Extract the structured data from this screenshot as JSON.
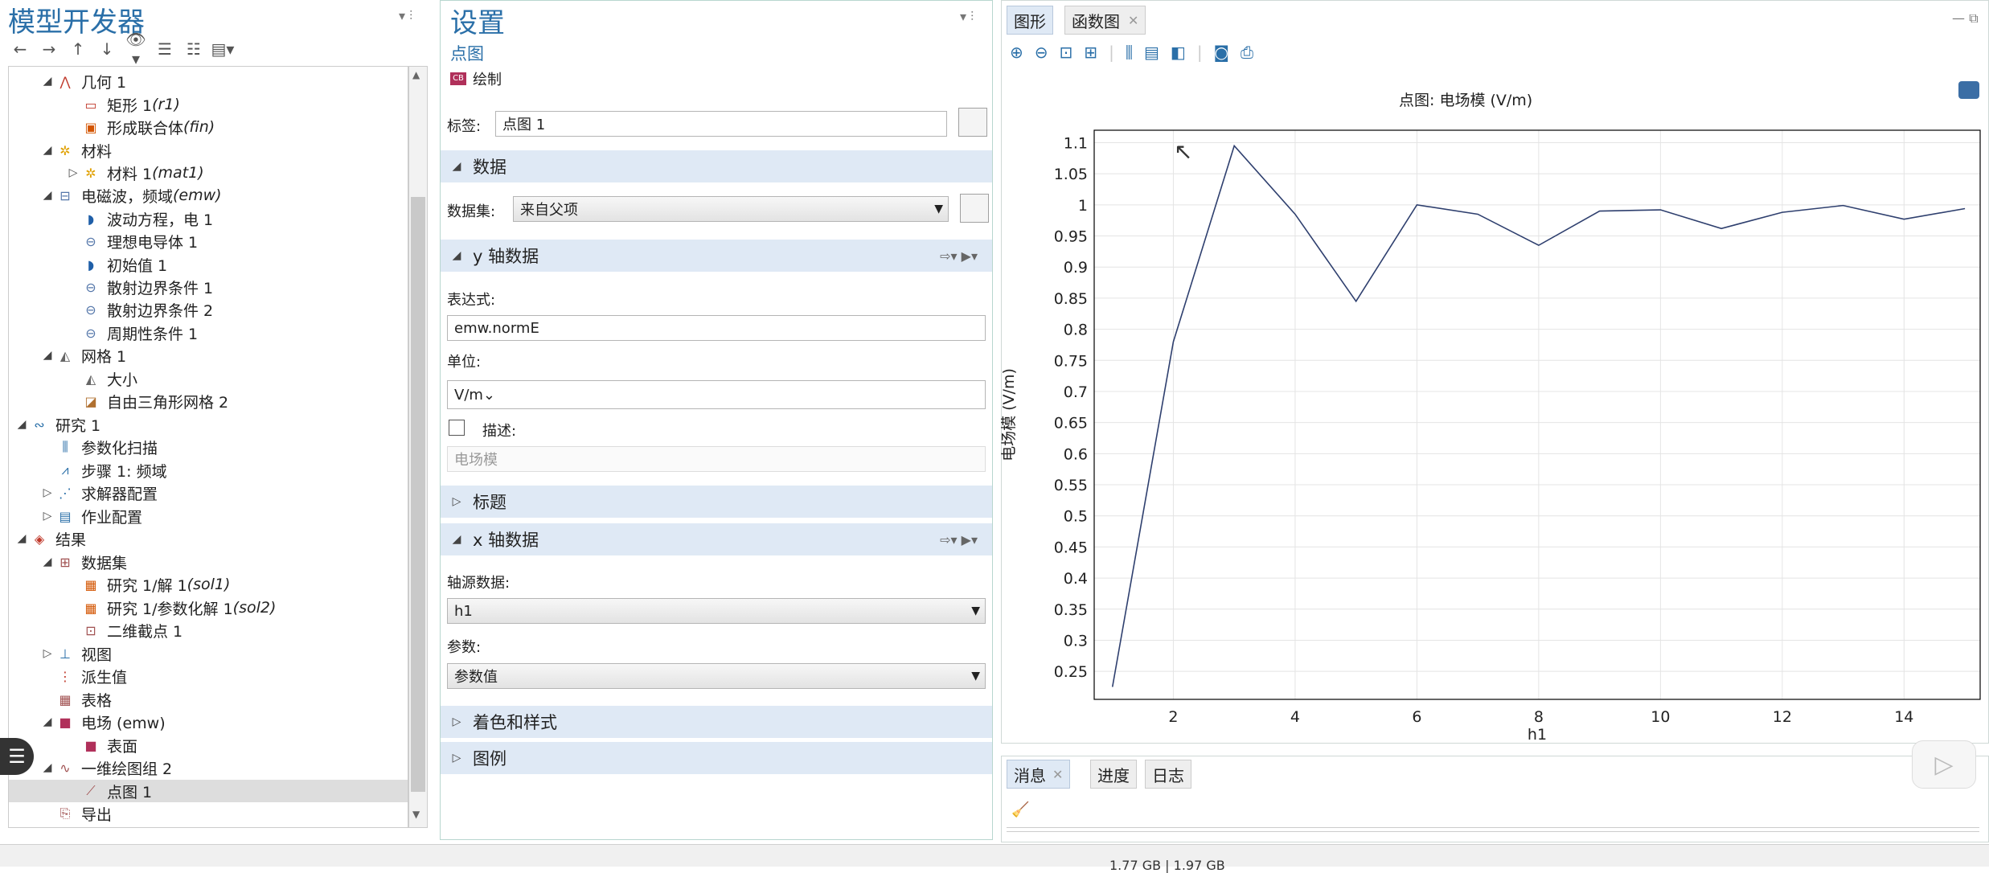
{
  "model_builder": {
    "title": "模型开发器",
    "tree": [
      {
        "label": "几何 1",
        "em": "",
        "indent": 2,
        "tw": "◢",
        "icon": "geometry-icon",
        "glyph": "⋀",
        "color": "#c0392b",
        "y": 96
      },
      {
        "label": "矩形 1 ",
        "em": "(r1)",
        "indent": 3,
        "tw": "",
        "icon": "rectangle-icon",
        "glyph": "▭",
        "color": "#c0392b",
        "y": 125
      },
      {
        "label": "形成联合体 ",
        "em": "(fin)",
        "indent": 3,
        "tw": "",
        "icon": "form-union-icon",
        "glyph": "▣",
        "color": "#d35400",
        "y": 153
      },
      {
        "label": "材料",
        "em": "",
        "indent": 2,
        "tw": "◢",
        "icon": "materials-icon",
        "glyph": "✲",
        "color": "#e0a000",
        "y": 182
      },
      {
        "label": "材料 1 ",
        "em": "(mat1)",
        "indent": 3,
        "tw": "▷",
        "icon": "material-icon",
        "glyph": "✲",
        "color": "#e0a000",
        "y": 210
      },
      {
        "label": "电磁波，频域 ",
        "em": "(emw)",
        "indent": 2,
        "tw": "◢",
        "icon": "emw-physics-icon",
        "glyph": "⊟",
        "color": "#5577aa",
        "y": 238
      },
      {
        "label": "波动方程，电 1",
        "em": "",
        "indent": 3,
        "tw": "",
        "icon": "wave-equation-icon",
        "glyph": "◗",
        "color": "#1f5fa8",
        "y": 267
      },
      {
        "label": "理想电导体 1",
        "em": "",
        "indent": 3,
        "tw": "",
        "icon": "pec-icon",
        "glyph": "⊖",
        "color": "#5577aa",
        "y": 295
      },
      {
        "label": "初始值 1",
        "em": "",
        "indent": 3,
        "tw": "",
        "icon": "initial-values-icon",
        "glyph": "◗",
        "color": "#1f5fa8",
        "y": 324
      },
      {
        "label": "散射边界条件 1",
        "em": "",
        "indent": 3,
        "tw": "",
        "icon": "scattering-boundary-icon",
        "glyph": "⊖",
        "color": "#5577aa",
        "y": 352
      },
      {
        "label": "散射边界条件 2",
        "em": "",
        "indent": 3,
        "tw": "",
        "icon": "scattering-boundary-icon",
        "glyph": "⊖",
        "color": "#5577aa",
        "y": 380
      },
      {
        "label": "周期性条件 1",
        "em": "",
        "indent": 3,
        "tw": "",
        "icon": "periodic-condition-icon",
        "glyph": "⊖",
        "color": "#5577aa",
        "y": 409
      },
      {
        "label": "网格 1",
        "em": "",
        "indent": 2,
        "tw": "◢",
        "icon": "mesh-icon",
        "glyph": "◭",
        "color": "#666",
        "y": 437
      },
      {
        "label": "大小",
        "em": "",
        "indent": 3,
        "tw": "",
        "icon": "size-icon",
        "glyph": "◭",
        "color": "#666",
        "y": 466
      },
      {
        "label": "自由三角形网格 2",
        "em": "",
        "indent": 3,
        "tw": "",
        "icon": "free-triangular-icon",
        "glyph": "◪",
        "color": "#b07030",
        "y": 494
      },
      {
        "label": "研究 1",
        "em": "",
        "indent": 1,
        "tw": "◢",
        "icon": "study-icon",
        "glyph": "∾",
        "color": "#2a6fa8",
        "y": 523
      },
      {
        "label": "参数化扫描",
        "em": "",
        "indent": 2,
        "tw": "",
        "icon": "parametric-sweep-icon",
        "glyph": "⫼",
        "color": "#2a6fa8",
        "y": 551
      },
      {
        "label": "步骤 1: 频域",
        "em": "",
        "indent": 2,
        "tw": "",
        "icon": "frequency-domain-icon",
        "glyph": "⩘",
        "color": "#2a6fa8",
        "y": 580
      },
      {
        "label": "求解器配置",
        "em": "",
        "indent": 2,
        "tw": "▷",
        "icon": "solver-config-icon",
        "glyph": "⋰",
        "color": "#2a6fa8",
        "y": 608
      },
      {
        "label": "作业配置",
        "em": "",
        "indent": 2,
        "tw": "▷",
        "icon": "job-config-icon",
        "glyph": "▤",
        "color": "#2a6fa8",
        "y": 637
      },
      {
        "label": "结果",
        "em": "",
        "indent": 1,
        "tw": "◢",
        "icon": "results-icon",
        "glyph": "◈",
        "color": "#c0392b",
        "y": 665
      },
      {
        "label": "数据集",
        "em": "",
        "indent": 2,
        "tw": "◢",
        "icon": "datasets-icon",
        "glyph": "⊞",
        "color": "#a05050",
        "y": 694
      },
      {
        "label": "研究 1/解 1 ",
        "em": "(sol1)",
        "indent": 3,
        "tw": "",
        "icon": "solution-dataset-icon",
        "glyph": "▦",
        "color": "#d35400",
        "y": 722
      },
      {
        "label": "研究 1/参数化解 1 ",
        "em": "(sol2)",
        "indent": 3,
        "tw": "",
        "icon": "parametric-solution-icon",
        "glyph": "▦",
        "color": "#d35400",
        "y": 751
      },
      {
        "label": "二维截点 1",
        "em": "",
        "indent": 3,
        "tw": "",
        "icon": "cut-point-icon",
        "glyph": "⊡",
        "color": "#a05050",
        "y": 779
      },
      {
        "label": "视图",
        "em": "",
        "indent": 2,
        "tw": "▷",
        "icon": "views-icon",
        "glyph": "⊥",
        "color": "#2a6fa8",
        "y": 808
      },
      {
        "label": "派生值",
        "em": "",
        "indent": 2,
        "tw": "",
        "icon": "derived-values-icon",
        "glyph": "⋮",
        "color": "#c0392b",
        "y": 836
      },
      {
        "label": "表格",
        "em": "",
        "indent": 2,
        "tw": "",
        "icon": "tables-icon",
        "glyph": "▦",
        "color": "#a05050",
        "y": 865
      },
      {
        "label": "电场 (emw)",
        "em": "",
        "indent": 2,
        "tw": "◢",
        "icon": "plot-group-2d-icon",
        "glyph": "■",
        "color": "#b0305a",
        "y": 893
      },
      {
        "label": "表面",
        "em": "",
        "indent": 3,
        "tw": "",
        "icon": "surface-plot-icon",
        "glyph": "■",
        "color": "#b0305a",
        "y": 922
      },
      {
        "label": "一维绘图组 2",
        "em": "",
        "indent": 2,
        "tw": "◢",
        "icon": "plot-group-1d-icon",
        "glyph": "∿",
        "color": "#a05050",
        "y": 950
      },
      {
        "label": "点图 1",
        "em": "",
        "indent": 3,
        "tw": "",
        "icon": "point-graph-icon",
        "glyph": "⟋",
        "color": "#a05050",
        "y": 979,
        "selected": true
      },
      {
        "label": "导出",
        "em": "",
        "indent": 2,
        "tw": "",
        "icon": "export-icon",
        "glyph": "⎘",
        "color": "#a05050",
        "y": 1007
      }
    ]
  },
  "settings": {
    "title": "设置",
    "subtitle": "点图",
    "plot_button": "绘制",
    "label_caption": "标签:",
    "label_value": "点图 1",
    "sections": {
      "data": "数据",
      "y_axis": "y 轴数据",
      "title": "标题",
      "x_axis": "x 轴数据",
      "coloring": "着色和样式",
      "legends": "图例"
    },
    "dataset_caption": "数据集:",
    "dataset_value": "来自父项",
    "expression_caption": "表达式:",
    "expression_value": "emw.normE",
    "unit_caption": "单位:",
    "unit_value": "V/m",
    "description_caption": "描述:",
    "description_value": "电场模",
    "axis_source_caption": "轴源数据:",
    "axis_source_value": "h1",
    "parameter_caption": "参数:",
    "parameter_value": "参数值"
  },
  "graphics": {
    "tab_graphics": "图形",
    "tab_function": "函数图",
    "plot_title": "点图: 电场模 (V/m)"
  },
  "chart_data": {
    "type": "line",
    "title": "点图: 电场模 (V/m)",
    "xlabel": "h1",
    "ylabel": "电场模 (V/m)",
    "x": [
      1,
      2,
      3,
      4,
      5,
      6,
      7,
      8,
      9,
      10,
      11,
      12,
      13,
      14,
      15
    ],
    "values": [
      0.225,
      0.78,
      1.095,
      0.985,
      0.845,
      1.0,
      0.985,
      0.935,
      0.99,
      0.992,
      0.962,
      0.988,
      0.999,
      0.977,
      0.994
    ],
    "xlim": [
      0.7,
      15.25
    ],
    "ylim": [
      0.205,
      1.12
    ],
    "xticks": [
      2,
      4,
      6,
      8,
      10,
      12,
      14
    ],
    "yticks": [
      0.25,
      0.3,
      0.35,
      0.4,
      0.45,
      0.5,
      0.55,
      0.6,
      0.65,
      0.7,
      0.75,
      0.8,
      0.85,
      0.9,
      0.95,
      1,
      1.05,
      1.1
    ],
    "line_color": "#2e3f6e",
    "grid": true
  },
  "messages": {
    "tab_messages": "消息",
    "tab_progress": "进度",
    "tab_log": "日志"
  },
  "status": {
    "memory": "1.77 GB | 1.97 GB"
  }
}
